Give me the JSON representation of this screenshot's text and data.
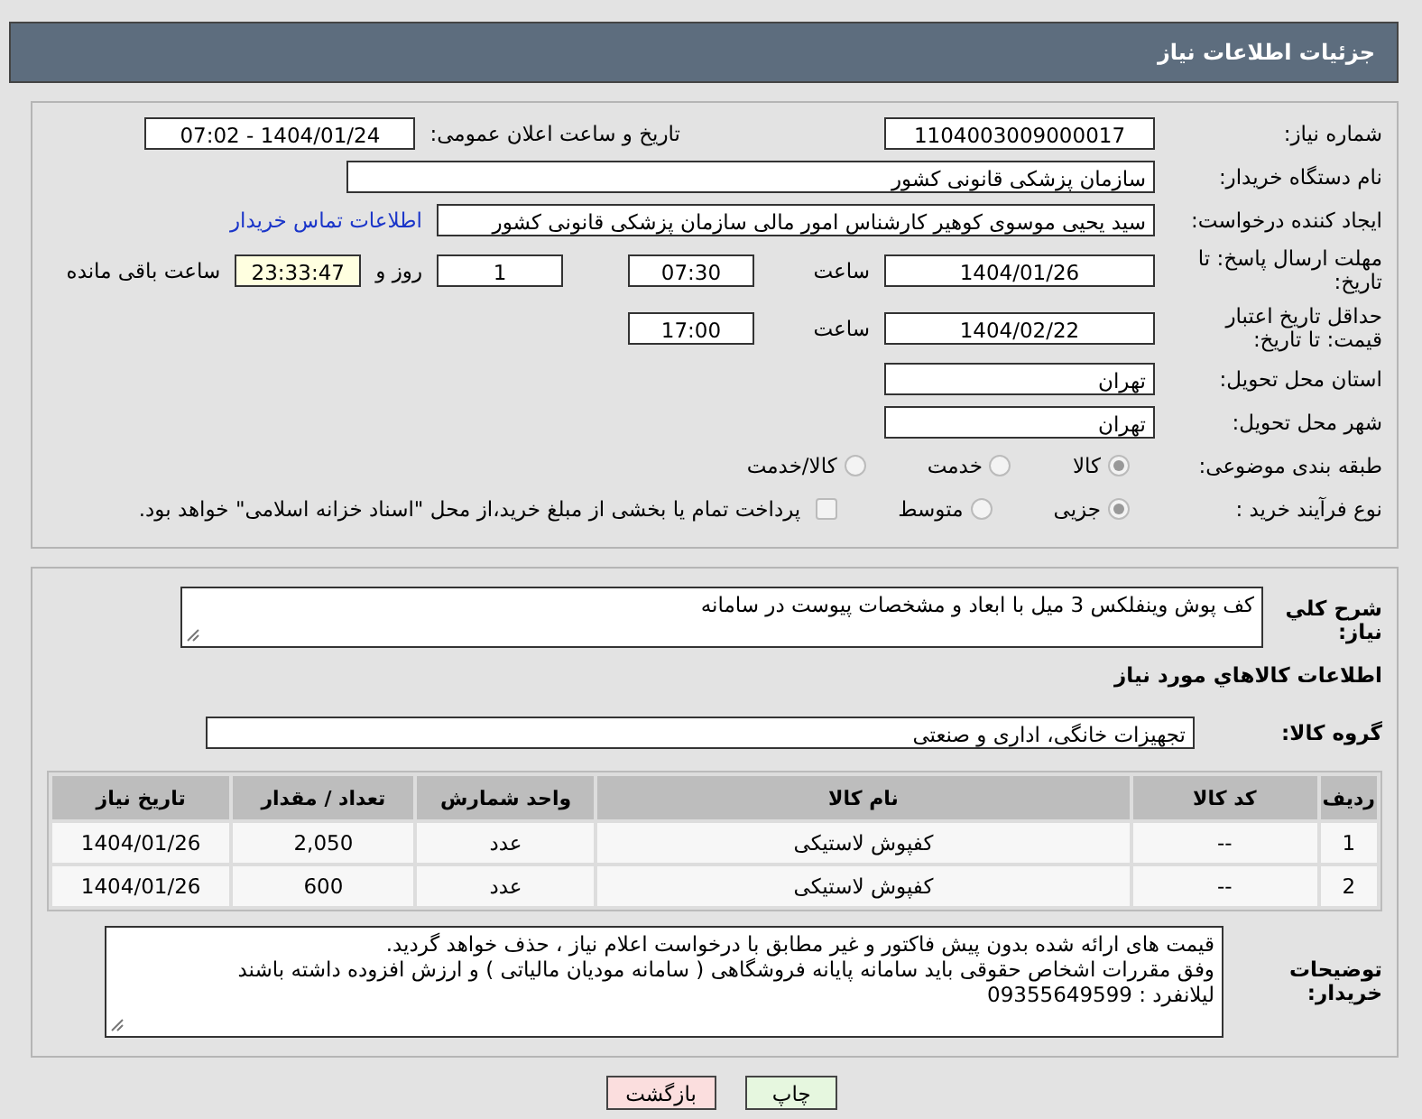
{
  "header": {
    "title": "جزئیات اطلاعات نیاز"
  },
  "need_number": {
    "label": "شماره نیاز:",
    "value": "1104003009000017"
  },
  "announce": {
    "label": "تاریخ و ساعت اعلان عمومی:",
    "value": "1404/01/24 - 07:02"
  },
  "buyer_org": {
    "label": "نام دستگاه خریدار:",
    "value": "سازمان پزشکی قانونی کشور"
  },
  "requester": {
    "label": "ایجاد کننده درخواست:",
    "value": "سید یحیی موسوی کوهیر کارشناس امور مالی سازمان پزشکی قانونی کشور",
    "link": "اطلاعات تماس خریدار"
  },
  "reply_deadline": {
    "label": "مهلت ارسال پاسخ: تا تاریخ:",
    "date": "1404/01/26",
    "time_label": "ساعت",
    "time": "07:30",
    "days": "1",
    "days_label": "روز و",
    "remaining": "23:33:47",
    "remaining_label": "ساعت باقی مانده"
  },
  "price_validity": {
    "label": "حداقل تاریخ اعتبار قیمت: تا تاریخ:",
    "date": "1404/02/22",
    "time_label": "ساعت",
    "time": "17:00"
  },
  "province": {
    "label": "استان محل تحویل:",
    "value": "تهران"
  },
  "city": {
    "label": "شهر محل تحویل:",
    "value": "تهران"
  },
  "category": {
    "label": "طبقه بندی موضوعی:",
    "options": [
      {
        "label": "کالا",
        "selected": true
      },
      {
        "label": "خدمت",
        "selected": false
      },
      {
        "label": "کالا/خدمت",
        "selected": false
      }
    ]
  },
  "process": {
    "label": "نوع فرآیند خرید :",
    "options": [
      {
        "label": "جزیی",
        "selected": true
      },
      {
        "label": "متوسط",
        "selected": false
      }
    ],
    "treasury": {
      "label": "پرداخت تمام یا بخشی از مبلغ خرید،از محل \"اسناد خزانه اسلامی\" خواهد بود.",
      "checked": false
    }
  },
  "description": {
    "label": "شرح کلي نياز:",
    "value": "کف پوش وینفلکس 3 میل با ابعاد و مشخصات پیوست در سامانه"
  },
  "goods": {
    "title": "اطلاعات کالاهاي مورد نياز",
    "group_label": "گروه کالا:",
    "group_value": "تجهیزات خانگی، اداری و صنعتی",
    "columns": [
      "ردیف",
      "کد کالا",
      "نام کالا",
      "واحد شمارش",
      "تعداد / مقدار",
      "تاریخ نیاز"
    ],
    "rows": [
      [
        "1",
        "--",
        "کفپوش لاستیکی",
        "عدد",
        "2,050",
        "1404/01/26"
      ],
      [
        "2",
        "--",
        "کفپوش لاستیکی",
        "عدد",
        "600",
        "1404/01/26"
      ]
    ]
  },
  "buyer_notes": {
    "label": "توضیحات خریدار:",
    "lines": [
      "قیمت های ارائه شده بدون پیش فاکتور  و غیر مطابق با درخواست اعلام نیاز  ، حذف خواهد گردید.",
      "وفق مقررات اشخاص حقوقی باید سامانه پایانه فروشگاهی ( سامانه مودیان مالیاتی ) و ارزش افزوده  داشته باشند",
      "لیلانفرد  :   09355649599"
    ]
  },
  "buttons": [
    {
      "label": "چاپ",
      "kind": "print"
    },
    {
      "label": "بازگشت",
      "kind": "back"
    }
  ]
}
